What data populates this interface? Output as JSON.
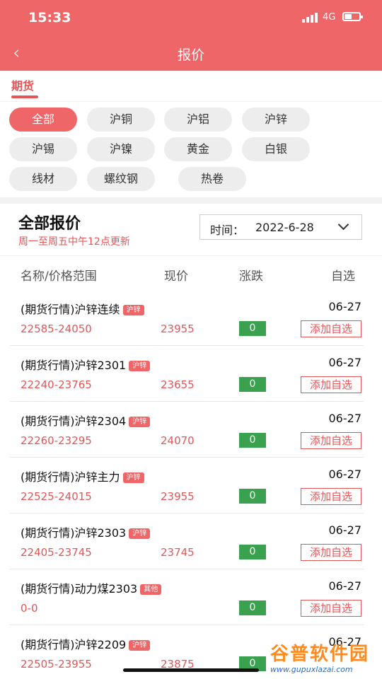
{
  "status_bar": {
    "time": "15:33",
    "network": "4G"
  },
  "nav": {
    "title": "报价"
  },
  "tabs": {
    "active": "期货"
  },
  "filters": [
    "全部",
    "沪铜",
    "沪铝",
    "沪锌",
    "沪锡",
    "沪镍",
    "黄金",
    "白银",
    "线材",
    "螺纹钢",
    "热卷"
  ],
  "summary": {
    "title": "全部报价",
    "subtitle": "周一至周五中午12点更新",
    "date_label": "时间：",
    "date_value": "2022-6-28"
  },
  "table": {
    "headers": {
      "name": "名称/价格范围",
      "price": "现价",
      "change": "涨跌",
      "watch": "自选"
    },
    "rows": [
      {
        "name": "(期货行情)沪锌连续",
        "tag": "沪锌",
        "date": "06-27",
        "range": "22585-24050",
        "price": "23955",
        "change": "0",
        "action": "添加自选"
      },
      {
        "name": "(期货行情)沪锌2301",
        "tag": "沪锌",
        "date": "06-27",
        "range": "22240-23765",
        "price": "23655",
        "change": "0",
        "action": "添加自选"
      },
      {
        "name": "(期货行情)沪锌2304",
        "tag": "沪锌",
        "date": "06-27",
        "range": "22260-23295",
        "price": "24070",
        "change": "0",
        "action": "添加自选"
      },
      {
        "name": "(期货行情)沪锌主力",
        "tag": "沪锌",
        "date": "06-27",
        "range": "22525-24015",
        "price": "23955",
        "change": "0",
        "action": "添加自选"
      },
      {
        "name": "(期货行情)沪锌2303",
        "tag": "沪锌",
        "date": "06-27",
        "range": "22405-23745",
        "price": "23745",
        "change": "0",
        "action": "添加自选"
      },
      {
        "name": "(期货行情)动力煤2303",
        "tag": "其他",
        "date": "06-27",
        "range": "0-0",
        "price": "",
        "change": "0",
        "action": "添加自选"
      },
      {
        "name": "(期货行情)沪锌2209",
        "tag": "沪锌",
        "date": "06-27",
        "range": "22505-23955",
        "price": "23875",
        "change": "0",
        "action": "添加自选"
      }
    ]
  },
  "watermark": {
    "title": "谷普软件园",
    "url": "www.gupuxlazai.com"
  },
  "colors": {
    "brand": "#ef6668",
    "accent_text": "#e15758",
    "change_green": "#3aa24e"
  }
}
